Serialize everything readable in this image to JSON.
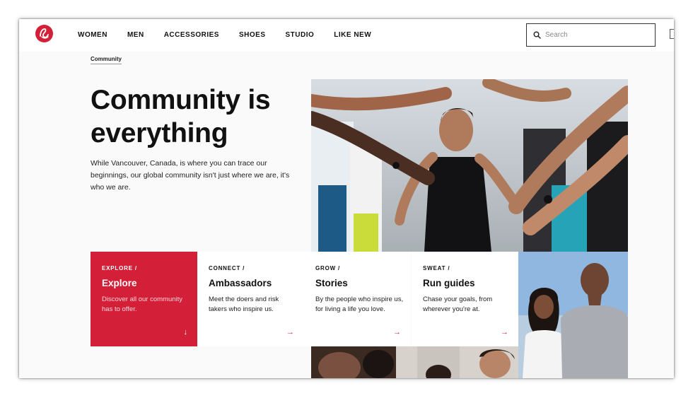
{
  "nav": {
    "items": [
      "WOMEN",
      "MEN",
      "ACCESSORIES",
      "SHOES",
      "STUDIO",
      "LIKE NEW"
    ]
  },
  "search": {
    "placeholder": "Search"
  },
  "breadcrumb": "Community",
  "hero": {
    "title": "Community is everything",
    "description": "While Vancouver, Canada, is where you can trace our beginnings, our global community isn't just where we are, it's who we are."
  },
  "cards": [
    {
      "eyebrow": "EXPLORE /",
      "title": "Explore",
      "description": "Discover all our community has to offer.",
      "arrow": "↓"
    },
    {
      "eyebrow": "CONNECT /",
      "title": "Ambassadors",
      "description": "Meet the doers and risk takers who inspire us.",
      "arrow": "→"
    },
    {
      "eyebrow": "GROW /",
      "title": "Stories",
      "description": "By the people who inspire us, for living a life you love.",
      "arrow": "→"
    },
    {
      "eyebrow": "SWEAT /",
      "title": "Run guides",
      "description": "Chase your goals, from wherever you're at.",
      "arrow": "→"
    }
  ],
  "colors": {
    "brand_red": "#d31f38",
    "text": "#111111",
    "background": "#fafafa"
  },
  "icons": {
    "logo": "lululemon-logo",
    "search": "search-icon"
  }
}
